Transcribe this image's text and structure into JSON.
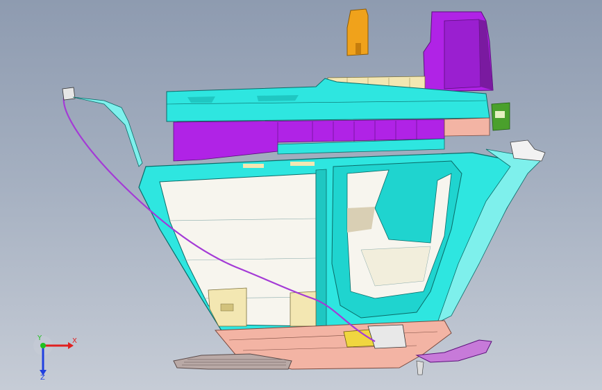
{
  "viewport": {
    "background_top": "#8e9bb0",
    "background_bottom": "#c6ccd6"
  },
  "model": {
    "colors": {
      "cyan_frame": "#2ee6e0",
      "cyan_dark": "#1a9c98",
      "magenta": "#b023e6",
      "magenta_dark": "#7a1aa0",
      "salmon": "#f3b4a4",
      "cream": "#f3e7b2",
      "white_panel": "#f7f5ee",
      "orange": "#f0a21b",
      "green": "#4aa02c",
      "gray_grille": "#b9a9a6",
      "cable": "#a43ad6"
    }
  },
  "triad": {
    "x_label": "X",
    "y_label": "Y",
    "z_label": "Z",
    "x_color": "#e02020",
    "y_color": "#20c020",
    "z_color": "#2040e0"
  }
}
